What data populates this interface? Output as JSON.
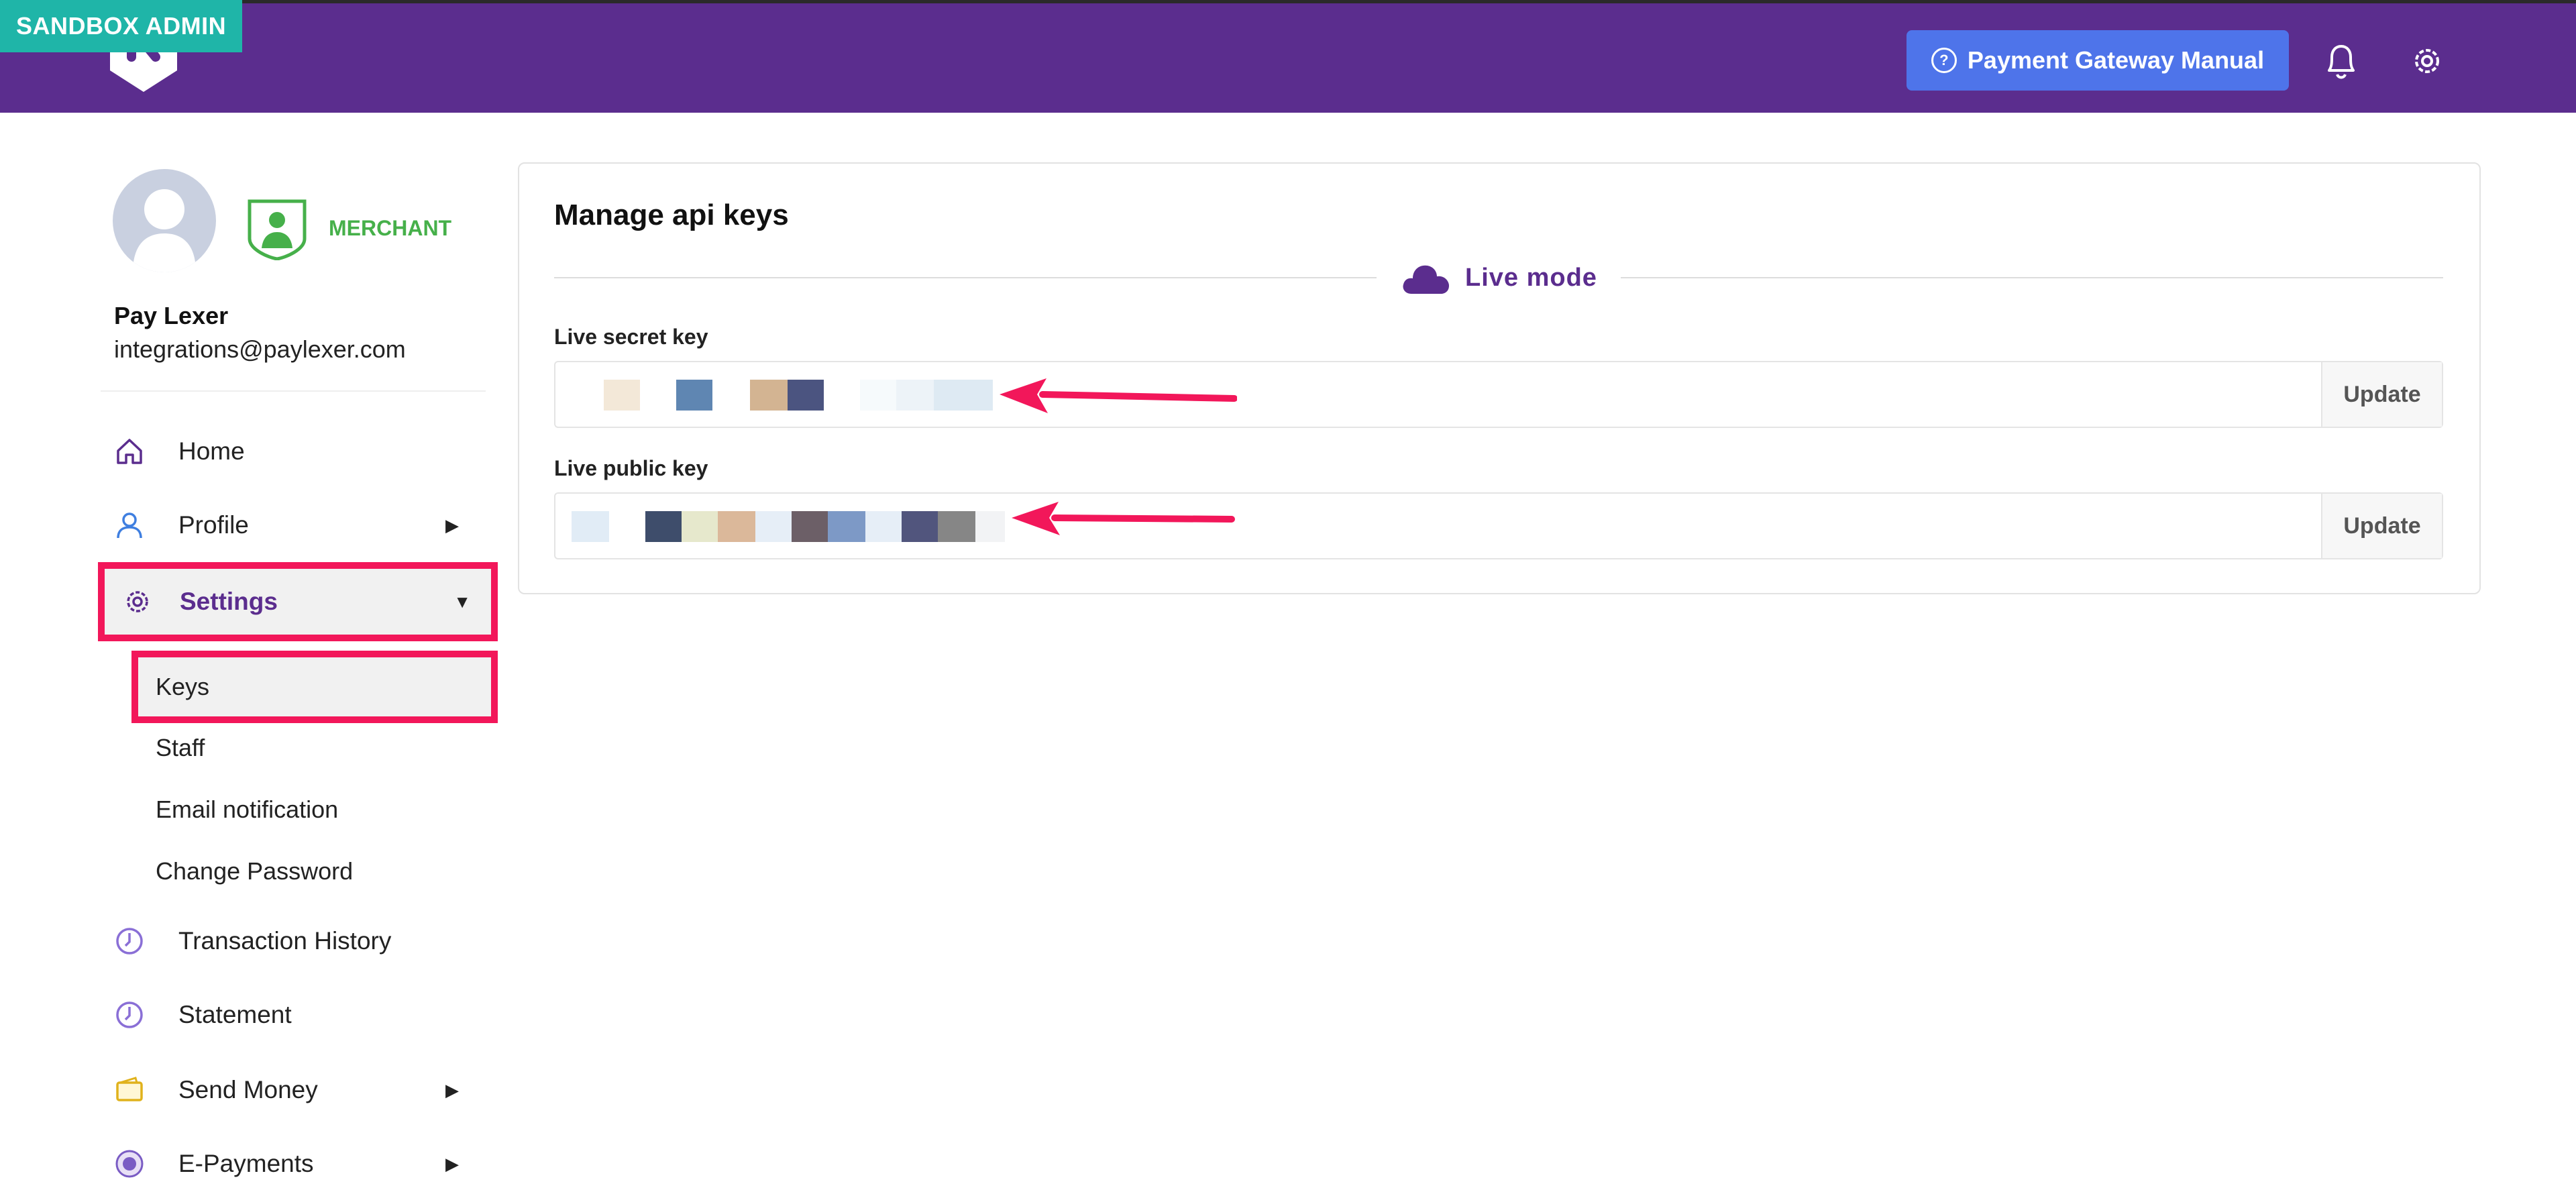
{
  "header": {
    "environment_badge": "SANDBOX ADMIN",
    "manual_button_label": "Payment Gateway Manual",
    "colors": {
      "bar": "#5b2d8e",
      "badge": "#1fb5a8",
      "button": "#4e74ea"
    }
  },
  "user": {
    "role": "MERCHANT",
    "name": "Pay Lexer",
    "email": "integrations@paylexer.com"
  },
  "sidebar": {
    "items": [
      {
        "label": "Home",
        "icon": "home-icon"
      },
      {
        "label": "Profile",
        "icon": "user-icon",
        "has_submenu": true
      },
      {
        "label": "Settings",
        "icon": "gear-icon",
        "has_submenu": true,
        "expanded": true
      },
      {
        "label": "Transaction History",
        "icon": "clock-icon"
      },
      {
        "label": "Statement",
        "icon": "clock-icon"
      },
      {
        "label": "Send Money",
        "icon": "wallet-icon",
        "has_submenu": true
      },
      {
        "label": "E-Payments",
        "icon": "epay-icon",
        "has_submenu": true
      }
    ],
    "settings_subitems": [
      "Keys",
      "Staff",
      "Email notification",
      "Change Password"
    ],
    "selected": "Keys",
    "highlight_color": "#f2175a"
  },
  "main": {
    "title": "Manage api keys",
    "mode_label": "Live mode",
    "secret_key": {
      "label": "Live secret key",
      "value": "",
      "update_label": "Update"
    },
    "public_key": {
      "label": "Live public key",
      "value": "",
      "update_label": "Update"
    }
  }
}
